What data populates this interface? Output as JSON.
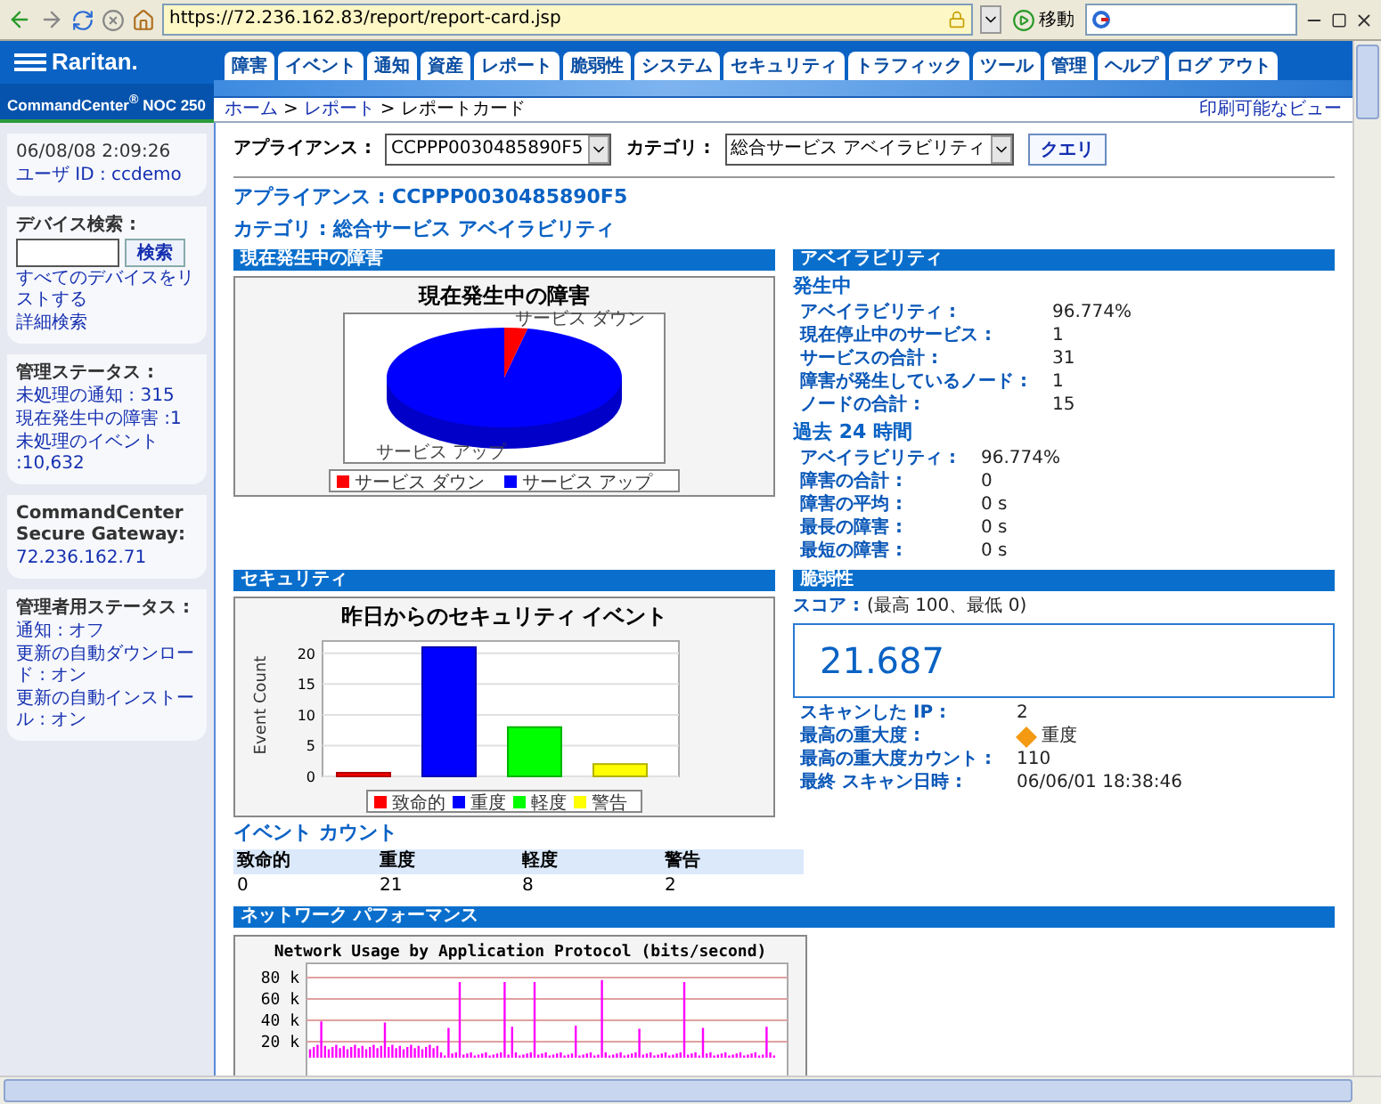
{
  "browser": {
    "address": "https://72.236.162.83/report/report-card.jsp",
    "go_label": "移動"
  },
  "header": {
    "logo": "Raritan.",
    "product": "CommandCenter$^{®}$ NOC 250",
    "tabs": [
      {
        "label": "障害",
        "selected": false
      },
      {
        "label": "イベント",
        "selected": false
      },
      {
        "label": "通知",
        "selected": false
      },
      {
        "label": "資産",
        "selected": false
      },
      {
        "label": "レポート",
        "selected": false
      },
      {
        "label": "脆弱性",
        "selected": false
      },
      {
        "label": "システム",
        "selected": false
      },
      {
        "label": "セキュリティ",
        "selected": false
      },
      {
        "label": "トラフィック",
        "selected": false
      },
      {
        "label": "ツール",
        "selected": false
      },
      {
        "label": "管理",
        "selected": false
      },
      {
        "label": "ヘルプ",
        "selected": false
      },
      {
        "label": "ログ アウト",
        "selected": false
      }
    ]
  },
  "breadcrumb": {
    "items": [
      "ホーム",
      "レポート",
      "レポートカード"
    ],
    "separator": ">",
    "print_link": "印刷可能なビュー"
  },
  "sidebar": {
    "datetime": "06/08/08 2:09:26",
    "user": "ユーザ ID : ccdemo",
    "device_search": {
      "title": "デバイス検索 :",
      "button": "検索",
      "links": [
        "すべてのデバイスをリストする",
        "詳細検索"
      ]
    },
    "cards": [
      {
        "title": "管理ステータス :",
        "lines": [
          "未処理の通知 : 315",
          "現在発生中の障害 :1",
          "未処理のイベント :10,632"
        ]
      },
      {
        "title": "CommandCenter Secure Gateway:",
        "lines": [
          "72.236.162.71"
        ]
      },
      {
        "title": "管理者用ステータス :",
        "lines": [
          "通知 : オフ",
          "更新の自動ダウンロード : オン",
          "更新の自動インストール : オン"
        ]
      }
    ]
  },
  "query": {
    "appliance_label": "アプライアンス :",
    "appliance_value": "CCPPP0030485890F5",
    "category_label": "カテゴリ :",
    "category_value": "総合サービス アベイラビリティ",
    "button": "クエリ"
  },
  "headings": [
    "アプライアンス : CCPPP0030485890F5",
    "カテゴリ : 総合サービス アベイラビリティ"
  ],
  "outages": {
    "header": "現在発生中の障害",
    "title": "現在発生中の障害",
    "slice_labels": [
      "サービス ダウン",
      "サービス アップ"
    ],
    "legend": [
      {
        "label": "サービス ダウン",
        "color": "#ff0000"
      },
      {
        "label": "サービス アップ",
        "color": "#0000ff"
      }
    ]
  },
  "availability": {
    "header": "アベイラビリティ",
    "groups": [
      {
        "title": "発生中",
        "rows": [
          {
            "label": "アベイラビリティ :",
            "value": "96.774%"
          },
          {
            "label": "現在停止中のサービス :",
            "value": "1"
          },
          {
            "label": "サービスの合計 :",
            "value": "31"
          },
          {
            "label": "障害が発生しているノード :",
            "value": "1"
          },
          {
            "label": "ノードの合計 :",
            "value": "15"
          }
        ]
      },
      {
        "title": "過去 24 時間",
        "rows": [
          {
            "label": "アベイラビリティ :",
            "value": "96.774%"
          },
          {
            "label": "障害の合計 :",
            "value": "0"
          },
          {
            "label": "障害の平均 :",
            "value": "0 s"
          },
          {
            "label": "最長の障害 :",
            "value": "0 s"
          },
          {
            "label": "最短の障害 :",
            "value": "0 s"
          }
        ]
      }
    ]
  },
  "security": {
    "header": "セキュリティ",
    "chart_data": {
      "type": "bar",
      "title": "昨日からのセキュリティ イベント",
      "ylabel": "Event Count",
      "yticks": [
        0,
        5,
        10,
        15,
        20
      ],
      "ylim": [
        0,
        22
      ],
      "stacked": true,
      "grid": true,
      "legend": true,
      "series": [
        {
          "name": "致命的",
          "color": "#ff0000",
          "values": [
            0,
            null,
            null,
            null
          ]
        },
        {
          "name": "重度",
          "color": "#0000ff",
          "values": [
            null,
            21,
            null,
            null
          ]
        },
        {
          "name": "軽度",
          "color": "#00ff00",
          "values": [
            null,
            null,
            8,
            null
          ]
        },
        {
          "name": "警告",
          "color": "#ffff00",
          "values": [
            null,
            null,
            null,
            2
          ]
        }
      ]
    },
    "event_count": {
      "title": "イベント カウント",
      "columns": [
        "致命的",
        "重度",
        "軽度",
        "警告"
      ],
      "row": [
        "0",
        "21",
        "8",
        "2"
      ]
    }
  },
  "vulnerability": {
    "header": "脆弱性",
    "score_label": "スコア :",
    "score_range": "(最高 100、最低 0)",
    "score": "21.687",
    "rows": [
      {
        "kind": "text",
        "label": "スキャンした IP :",
        "value": "2"
      },
      {
        "kind": "severity",
        "label": "最高の重大度 :",
        "value": "重度"
      },
      {
        "kind": "text",
        "label": "最高の重大度カウント :",
        "value": "110"
      },
      {
        "kind": "text",
        "label": "最終 スキャン日時 :",
        "value": "06/06/01 18:38:46"
      }
    ]
  },
  "network": {
    "header": "ネットワーク パフォーマンス",
    "chart_title": "Network Usage by Application Protocol (bits/second)",
    "y_labels": [
      "80 k",
      "60 k",
      "40 k",
      "20 k"
    ]
  }
}
